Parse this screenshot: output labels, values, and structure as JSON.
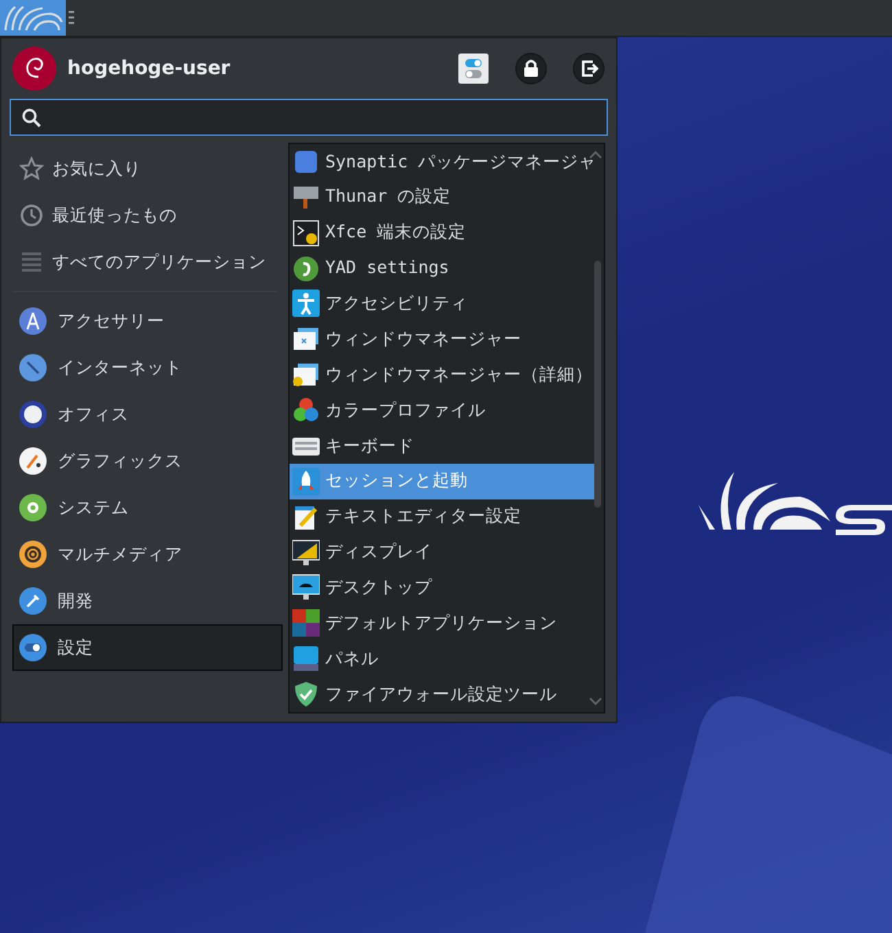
{
  "panel": {
    "launcher": {
      "active": true
    }
  },
  "menu": {
    "user_name": "hogehoge-user",
    "search": {
      "focused": true
    },
    "places": [
      {
        "label": "お気に入り",
        "selected": false
      },
      {
        "label": "最近使ったもの",
        "selected": false
      },
      {
        "label": "すべてのアプリケーション",
        "selected": false
      }
    ],
    "categories": [
      {
        "label": "アクセサリー",
        "selected": false
      },
      {
        "label": "インターネット",
        "selected": false
      },
      {
        "label": "オフィス",
        "selected": false
      },
      {
        "label": "グラフィックス",
        "selected": false
      },
      {
        "label": "システム",
        "selected": false
      },
      {
        "label": "マルチメディア",
        "selected": false
      },
      {
        "label": "開発",
        "selected": false
      },
      {
        "label": "設定",
        "selected": true
      }
    ],
    "apps": [
      {
        "label": "Synaptic パッケージマネージャ",
        "selected": false
      },
      {
        "label": "Thunar の設定",
        "selected": false
      },
      {
        "label": "Xfce 端末の設定",
        "selected": false
      },
      {
        "label": "YAD settings",
        "selected": false
      },
      {
        "label": "アクセシビリティ",
        "selected": false
      },
      {
        "label": "ウィンドウマネージャー",
        "selected": false
      },
      {
        "label": "ウィンドウマネージャー（詳細）",
        "selected": false
      },
      {
        "label": "カラープロファイル",
        "selected": false
      },
      {
        "label": "キーボード",
        "selected": false
      },
      {
        "label": "セッションと起動",
        "selected": true
      },
      {
        "label": "テキストエディター設定",
        "selected": false
      },
      {
        "label": "ディスプレイ",
        "selected": false
      },
      {
        "label": "デスクトップ",
        "selected": false
      },
      {
        "label": "デフォルトアプリケーション",
        "selected": false
      },
      {
        "label": "パネル",
        "selected": false
      },
      {
        "label": "ファイアウォール設定ツール",
        "selected": false
      }
    ]
  }
}
